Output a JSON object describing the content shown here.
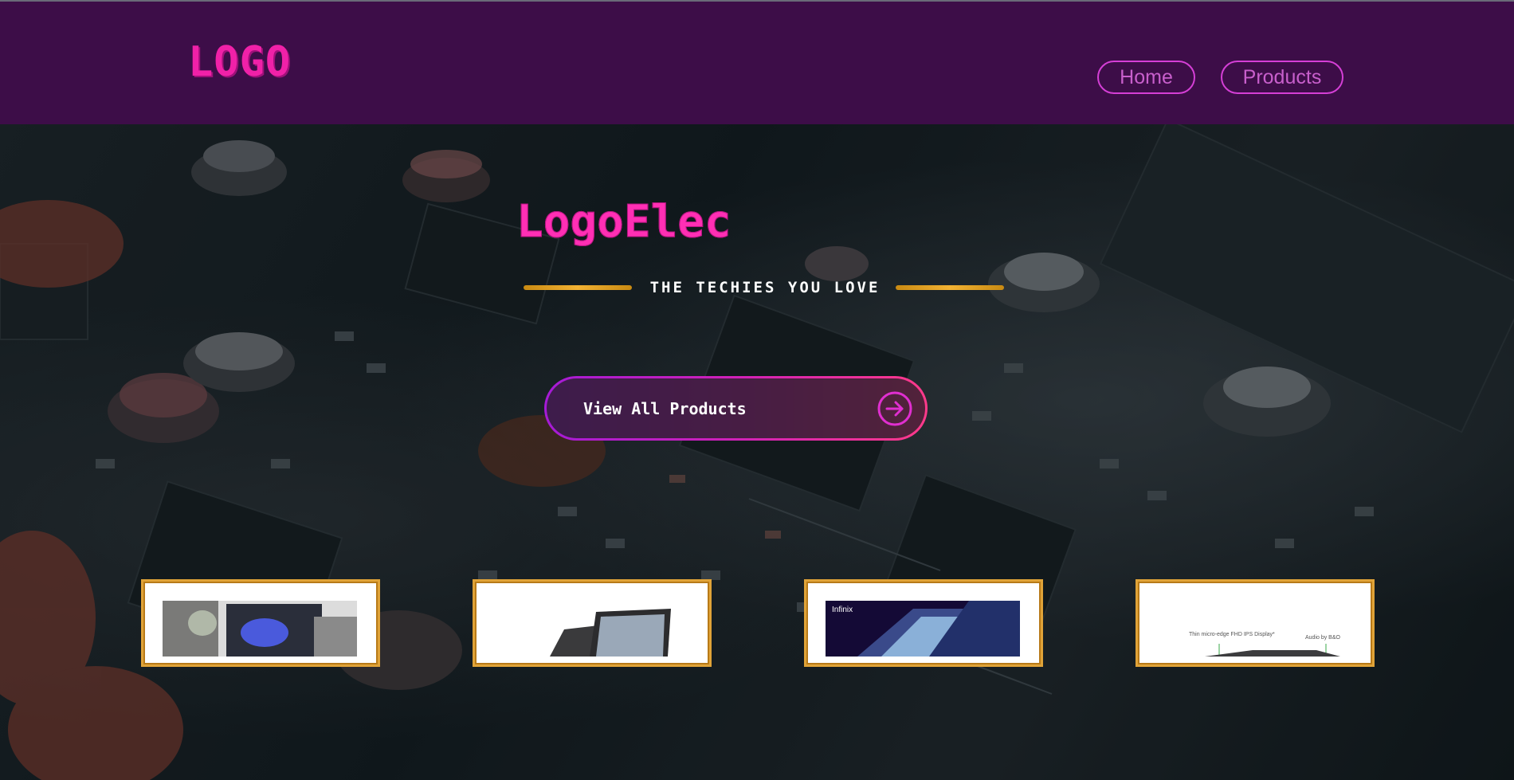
{
  "header": {
    "logo_text": "LOGO",
    "nav": [
      {
        "label": "Home"
      },
      {
        "label": "Products"
      }
    ]
  },
  "hero": {
    "brand": "LogoElec",
    "tagline": "THE TECHIES YOU LOVE",
    "cta_label": "View All Products",
    "cta_icon": "arrow-right-circle-icon"
  },
  "cards": [
    {
      "image_icon": "laptop-desk-photo"
    },
    {
      "image_icon": "laptops-photo"
    },
    {
      "image_icon": "infinix-laptop-photo",
      "image_text": "Infinix"
    },
    {
      "image_icon": "laptop-spec-photo",
      "spec_left": "Thin micro-edge FHD IPS Display*",
      "spec_right": "Audio by B&O"
    }
  ],
  "colors": {
    "header_bg": "#3d0d48",
    "accent_pink": "#ff2fb4",
    "nav_border": "#d53fd6",
    "gold": "#e0a338"
  }
}
